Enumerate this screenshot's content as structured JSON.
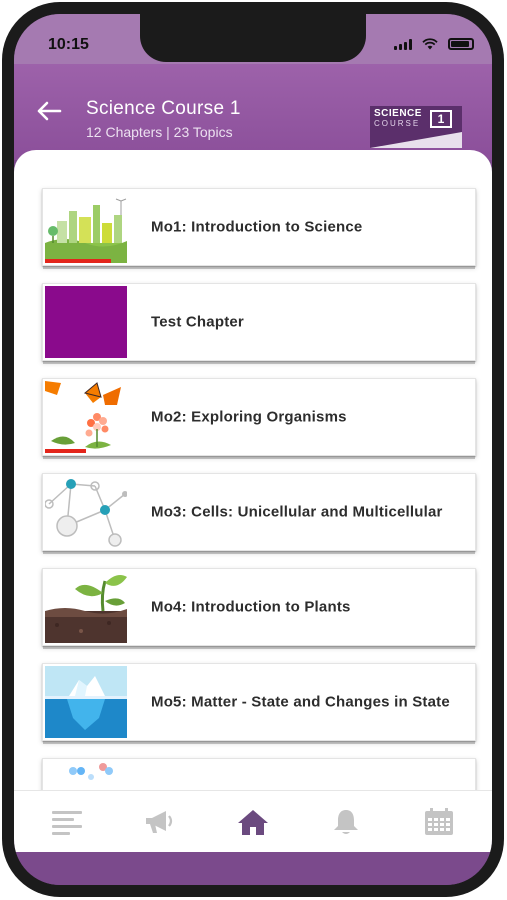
{
  "status_bar": {
    "time": "10:15"
  },
  "header": {
    "title": "Science Course 1",
    "subtitle": "12 Chapters | 23 Topics",
    "logo": {
      "line1": "SCIENCE",
      "line2": "COURSE",
      "number": "1"
    }
  },
  "chapters": [
    {
      "title": "Mo1: Introduction to Science",
      "thumbnail": "city-skyline-thumbnail",
      "progress": 0.8
    },
    {
      "title": "Test Chapter",
      "thumbnail": "purple-placeholder-thumbnail",
      "progress": 0
    },
    {
      "title": "Mo2: Exploring Organisms",
      "thumbnail": "butterflies-flowers-thumbnail",
      "progress": 0.5
    },
    {
      "title": "Mo3: Cells: Unicellular and Multicellular",
      "thumbnail": "cell-network-thumbnail",
      "progress": 0
    },
    {
      "title": "Mo4: Introduction to Plants",
      "thumbnail": "plant-sprout-thumbnail",
      "progress": 0
    },
    {
      "title": "Mo5: Matter - State and Changes in State",
      "thumbnail": "iceberg-thumbnail",
      "progress": 0
    },
    {
      "title": "",
      "thumbnail": "molecules-thumbnail",
      "progress": 0
    }
  ],
  "bottom_nav": [
    {
      "icon": "menu-icon",
      "active": false
    },
    {
      "icon": "megaphone-icon",
      "active": false
    },
    {
      "icon": "home-icon",
      "active": true
    },
    {
      "icon": "bell-icon",
      "active": false
    },
    {
      "icon": "calendar-icon",
      "active": false
    }
  ],
  "colors": {
    "brand_purple": "#8b4f9a",
    "test_chapter_purple": "#8a0a8c",
    "progress_red": "#e3251b",
    "nav_active": "#6b4a7f",
    "nav_inactive": "#c4c4c4"
  }
}
